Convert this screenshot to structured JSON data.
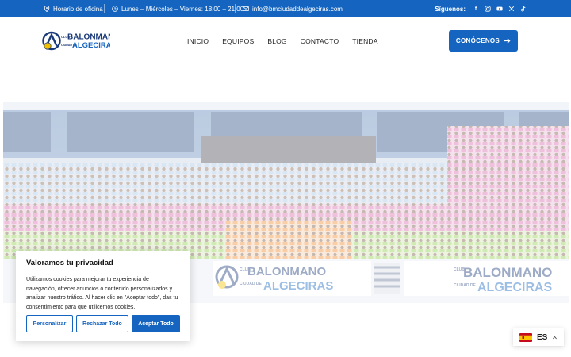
{
  "topbar": {
    "hours_label": "Horario de oficina",
    "schedule": "Lunes – Miércoles – Viernes: 18:00 – 21:00",
    "email": "info@bmciudaddealgeciras.com",
    "follow_label": "Síguenos:",
    "social_icons": [
      "facebook-icon",
      "instagram-icon",
      "youtube-icon",
      "x-icon",
      "tiktok-icon"
    ]
  },
  "logo": {
    "club": "CLUB",
    "name": "BALONMANO",
    "ciudad": "CIUDAD DE",
    "city": "ALGECIRAS"
  },
  "nav": {
    "items": [
      "INICIO",
      "EQUIPOS",
      "BLOG",
      "CONTACTO",
      "TIENDA"
    ]
  },
  "cta": {
    "label": "CONÓCENOS"
  },
  "hero": {
    "banner_left": {
      "club": "CLUB",
      "name": "BALONMANO",
      "ciudad": "CIUDAD DE",
      "city": "ALGECIRAS"
    },
    "banner_right": {
      "club": "CLUB",
      "name": "BALONMANO",
      "ciudad": "CIUDAD DE",
      "city": "ALGECIRAS"
    }
  },
  "cookie": {
    "title": "Valoramos tu privacidad",
    "body": "Utilizamos cookies para mejorar tu experiencia de navegación, ofrecer anuncios o contenido personalizados y analizar nuestro tráfico. Al hacer clic en \"Aceptar todo\", das tu consentimiento para que utilicemos cookies.",
    "customize": "Personalizar",
    "reject": "Rechazar Todo",
    "accept": "Aceptar Todo"
  },
  "language": {
    "code": "ES"
  },
  "colors": {
    "primary": "#1565c0",
    "accent_yellow": "#f2c200"
  }
}
